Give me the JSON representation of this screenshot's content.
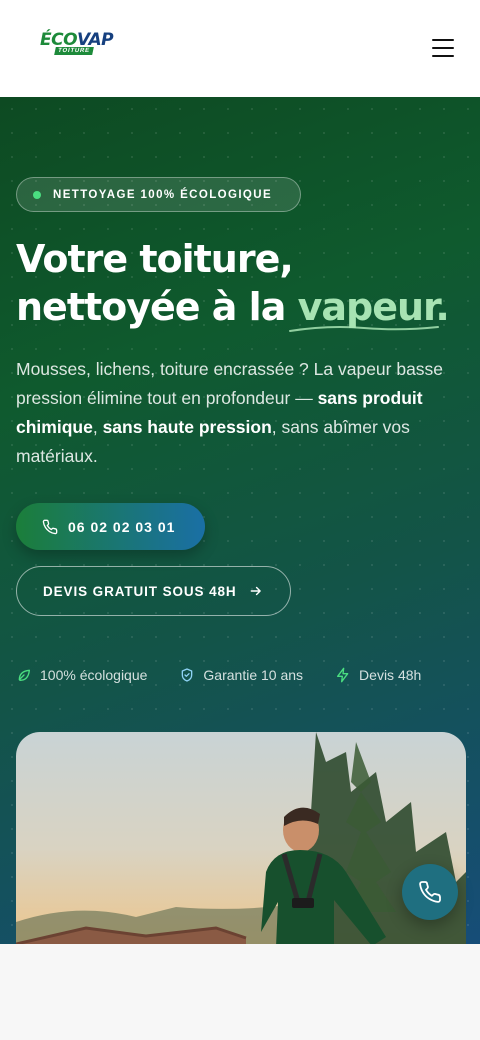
{
  "header": {
    "logo": {
      "eco": "ÉCO",
      "vap": "VAP",
      "sub": "TOITURE"
    },
    "menu_icon": "hamburger-menu-icon"
  },
  "hero": {
    "badge": "NETTOYAGE 100% ÉCOLOGIQUE",
    "title_line1": "Votre toiture,",
    "title_line2_prefix": "nettoyée à la ",
    "title_accent": "vapeur.",
    "description": {
      "part1": "Mousses, lichens, toiture encrassée ? La vapeur basse pression élimine tout en profondeur — ",
      "bold1": "sans produit chimique",
      "sep": ", ",
      "bold2": "sans haute pression",
      "part2": ", sans abîmer vos matériaux."
    },
    "phone_button": {
      "label": "06 02 02 03 01",
      "icon": "phone-icon"
    },
    "quote_button": {
      "label": "DEVIS GRATUIT SOUS 48H",
      "icon": "arrow-right-icon"
    },
    "features": [
      {
        "label": "100% écologique",
        "icon": "leaf-icon"
      },
      {
        "label": "Garantie 10 ans",
        "icon": "shield-check-icon"
      },
      {
        "label": "Devis 48h",
        "icon": "lightning-icon"
      }
    ],
    "photo": {
      "subject": "worker-in-harness-photo"
    }
  },
  "fab": {
    "icon": "phone-icon"
  },
  "colors": {
    "green": "#1d8a3a",
    "blue": "#16407f",
    "accent": "#a7e3b3",
    "hero_dark": "#0d4a22"
  }
}
